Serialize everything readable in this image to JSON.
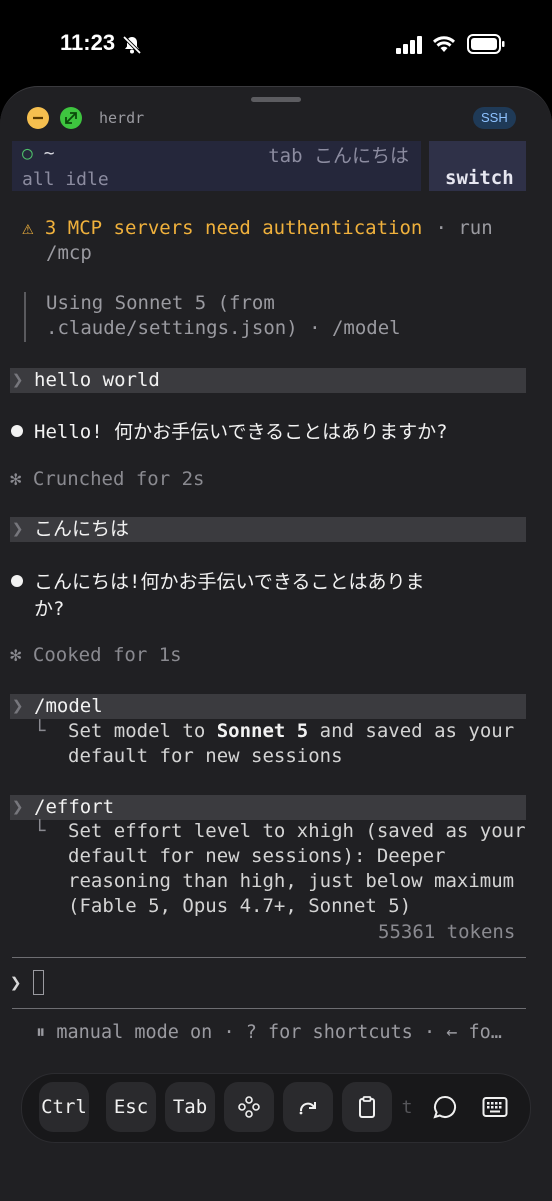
{
  "status": {
    "time": "11:23"
  },
  "window": {
    "title": "herdr",
    "badge": "SSH"
  },
  "tab": {
    "dir": "~",
    "tab_label": "tab こんにちは",
    "status": "all idle",
    "switch_label": "switch"
  },
  "transcript": {
    "warning_line1": "⚠ 3 MCP servers need authentication",
    "warning_sep": " · run",
    "warning_line2": "/mcp",
    "model_note1": "Using Sonnet 5 (from",
    "model_note2": ".claude/settings.json) · /model",
    "prompt1": "hello world",
    "reply1": "Hello! 何かお手伝いできることはありますか?",
    "timing1": "✻ Crunched for 2s",
    "prompt2": "こんにちは",
    "reply2_line1": "こんにちは!何かお手伝いできることはありま",
    "reply2_line2": "か?",
    "timing2": "✻ Cooked for 1s",
    "cmd1": "/model",
    "cmd1_out_line1_a": "Set model to ",
    "cmd1_out_line1_b": "Sonnet 5",
    "cmd1_out_line1_c": " and saved as your",
    "cmd1_out_line2": "default for new sessions",
    "cmd2": "/effort",
    "cmd2_out_line1": "Set effort level to xhigh (saved as your",
    "cmd2_out_line2": "default for new sessions): Deeper",
    "cmd2_out_line3": "reasoning than high, just below maximum",
    "cmd2_out_line4": "(Fable 5, Opus 4.7+, Sonnet 5)",
    "tokens": "55361 tokens"
  },
  "input": {
    "prompt_symbol": "❯"
  },
  "footer": {
    "mode_text": "⏸ manual mode on · ? for shortcuts · ← fo…"
  },
  "toolbar": {
    "ctrl": "Ctrl",
    "esc": "Esc",
    "tab": "Tab",
    "icons": [
      "gamepad-icon",
      "redo-icon",
      "clipboard-icon",
      "chat-icon",
      "keyboard-icon"
    ]
  },
  "colors": {
    "accent_warning": "#f0b13c",
    "ssh_badge": "#8ec2ff"
  }
}
